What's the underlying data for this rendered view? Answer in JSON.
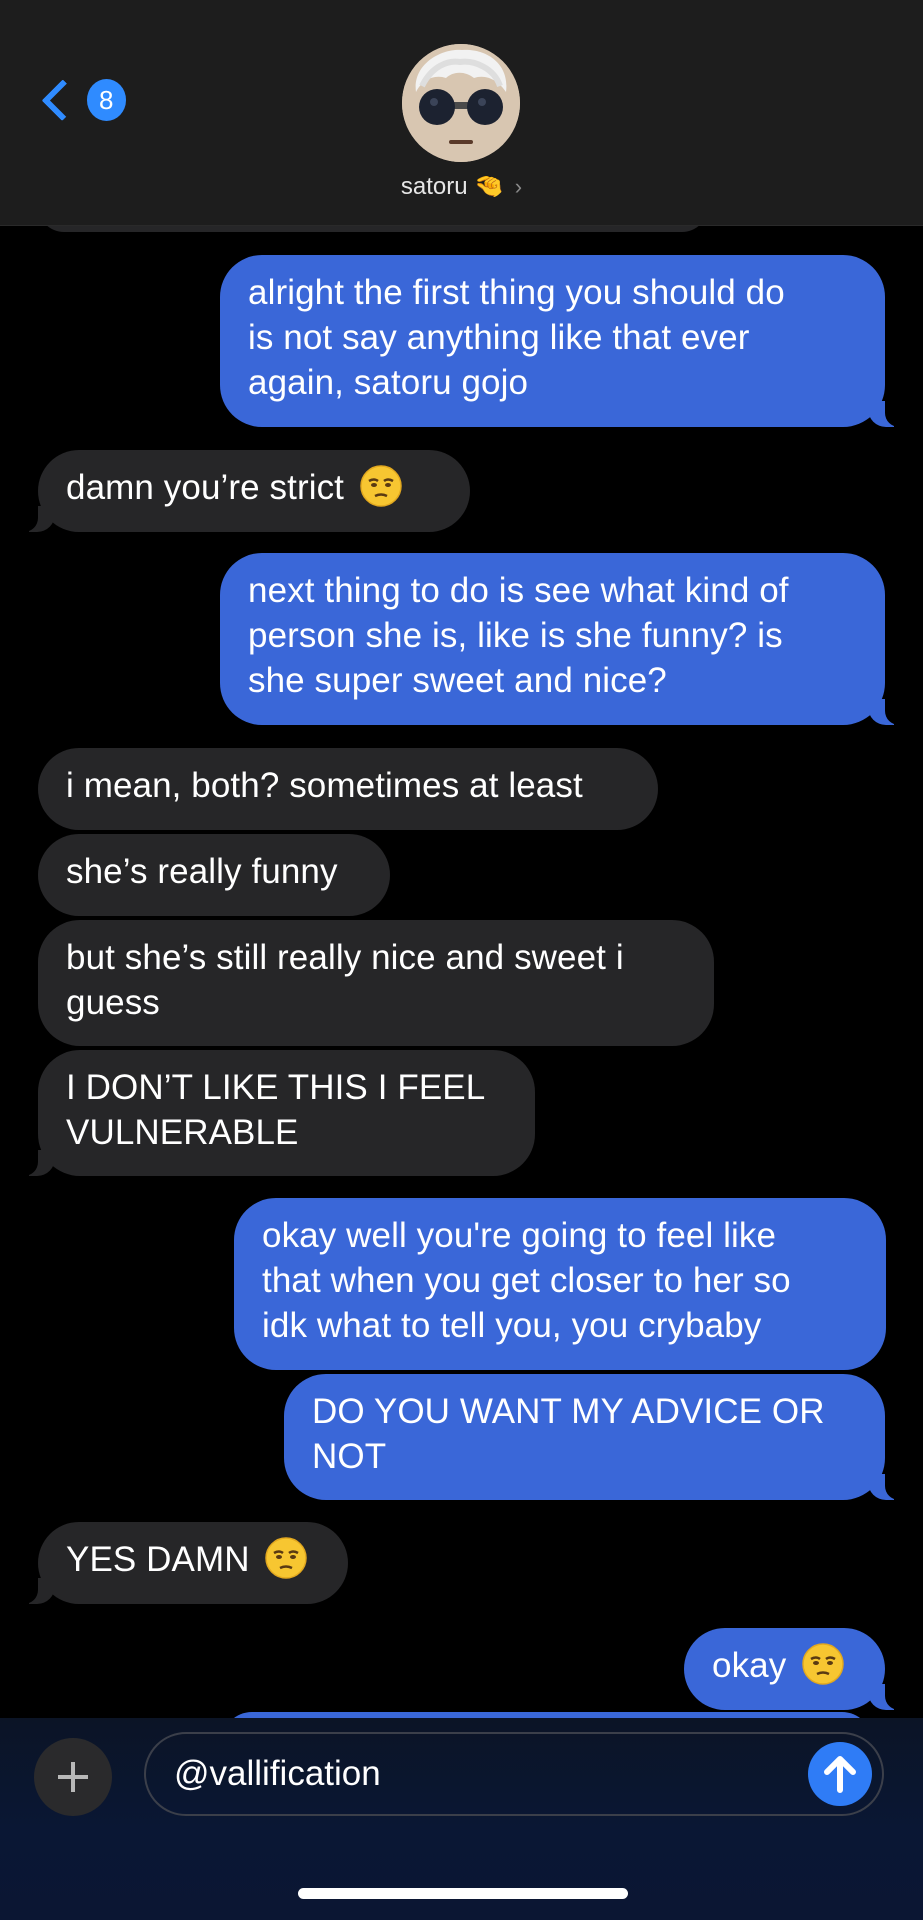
{
  "header": {
    "back_count": "8",
    "contact_name": "satoru",
    "contact_emoji": "🤏"
  },
  "messages": [
    {
      "from": "me",
      "lines": [
        "alright the first thing you should do",
        "is not say anything like that ever",
        "again, satoru gojo"
      ]
    },
    {
      "from": "them",
      "text": "damn you’re strict",
      "emoji": "unamused-face"
    },
    {
      "from": "me",
      "lines": [
        "next thing to do is see what kind of",
        "person she is, like is she funny? is",
        "she super sweet and nice?"
      ]
    },
    {
      "from": "them",
      "text": "i mean, both? sometimes at least"
    },
    {
      "from": "them",
      "text": "she’s really funny"
    },
    {
      "from": "them",
      "lines": [
        "but she’s still really nice and sweet i",
        "guess"
      ]
    },
    {
      "from": "them",
      "lines": [
        "I DON’T LIKE THIS I FEEL",
        "VULNERABLE"
      ]
    },
    {
      "from": "me",
      "lines": [
        "okay well you're going to feel like",
        "that when you get closer to her so",
        "idk what to tell you, you crybaby"
      ]
    },
    {
      "from": "me",
      "lines": [
        "DO YOU WANT MY ADVICE OR",
        "NOT"
      ]
    },
    {
      "from": "them",
      "text": "YES DAMN",
      "emoji": "unamused-face"
    },
    {
      "from": "me",
      "text": "okay",
      "emoji": "unamused-face"
    }
  ],
  "composer": {
    "input_value": "@vallification"
  },
  "colors": {
    "incoming_bubble": "#262628",
    "outgoing_bubble": "#3a67d8",
    "accent": "#2f8bff"
  },
  "icons": {
    "back": "chevron-left-icon",
    "add": "plus-icon",
    "send": "arrow-up-icon",
    "emoji": "unamused-face-emoji"
  }
}
